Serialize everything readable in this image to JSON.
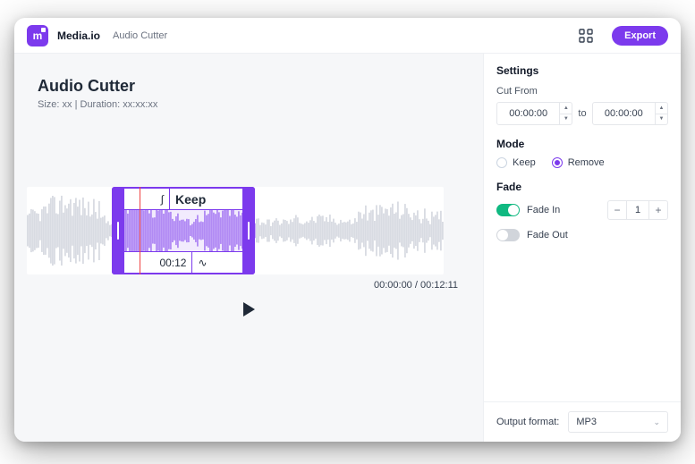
{
  "topbar": {
    "brand": "Media.io",
    "breadcrumb": "Audio Cutter",
    "export_label": "Export"
  },
  "main": {
    "title": "Audio Cutter",
    "size_prefix": "Size: ",
    "size_value": "xx",
    "duration_prefix": "Duration: ",
    "duration_value": "xx:xx:xx",
    "selection_label": "Keep",
    "selection_time": "00:12",
    "current_time": "00:00:00",
    "total_time": "00:12:11",
    "time_separator": " / "
  },
  "settings": {
    "title": "Settings",
    "cut_from_label": "Cut From",
    "from_value": "00:00:00",
    "to_label": "to",
    "to_value": "00:00:00",
    "mode_title": "Mode",
    "mode_keep": "Keep",
    "mode_remove": "Remove",
    "mode_selected": "Remove",
    "fade_title": "Fade",
    "fade_in_label": "Fade In",
    "fade_in_on": true,
    "fade_in_value": "1",
    "fade_out_label": "Fade Out",
    "fade_out_on": false,
    "output_format_label": "Output format:",
    "output_format_value": "MP3"
  },
  "colors": {
    "accent": "#7c3aed",
    "toggle_on": "#10b981"
  }
}
